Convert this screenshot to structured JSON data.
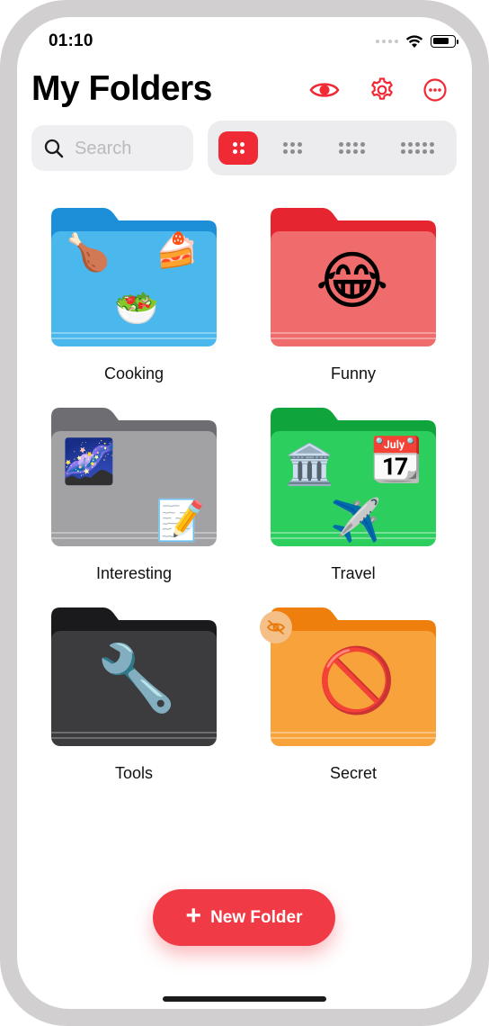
{
  "status_bar": {
    "time": "01:10"
  },
  "header": {
    "title": "My Folders",
    "icons": [
      "eye-icon",
      "gear-icon",
      "more-icon"
    ]
  },
  "search": {
    "placeholder": "Search"
  },
  "grid_size_selector": {
    "options": [
      "2x2",
      "2x3",
      "2x4",
      "2x5"
    ],
    "selected": "2x2"
  },
  "folders": [
    {
      "label": "Cooking",
      "color": "#4ab8ec",
      "emojis": [
        "🍗",
        "🍰",
        "🥗"
      ],
      "hidden": false
    },
    {
      "label": "Funny",
      "color": "#f06b6b",
      "emojis": [
        "😂"
      ],
      "hidden": false
    },
    {
      "label": "Interesting",
      "color": "#9f9fa2",
      "emojis": [
        "🌌",
        "📝"
      ],
      "hidden": false
    },
    {
      "label": "Travel",
      "color": "#2ccf5e",
      "emojis": [
        "🏛️",
        "📆",
        "✈️"
      ],
      "hidden": false
    },
    {
      "label": "Tools",
      "color": "#3c3c3f",
      "emojis": [
        "🔧"
      ],
      "hidden": false
    },
    {
      "label": "Secret",
      "color": "#f7a23b",
      "emojis": [
        "🚫"
      ],
      "hidden": true
    }
  ],
  "new_folder_button": {
    "label": "New Folder"
  },
  "accent_color": "#f02a35"
}
